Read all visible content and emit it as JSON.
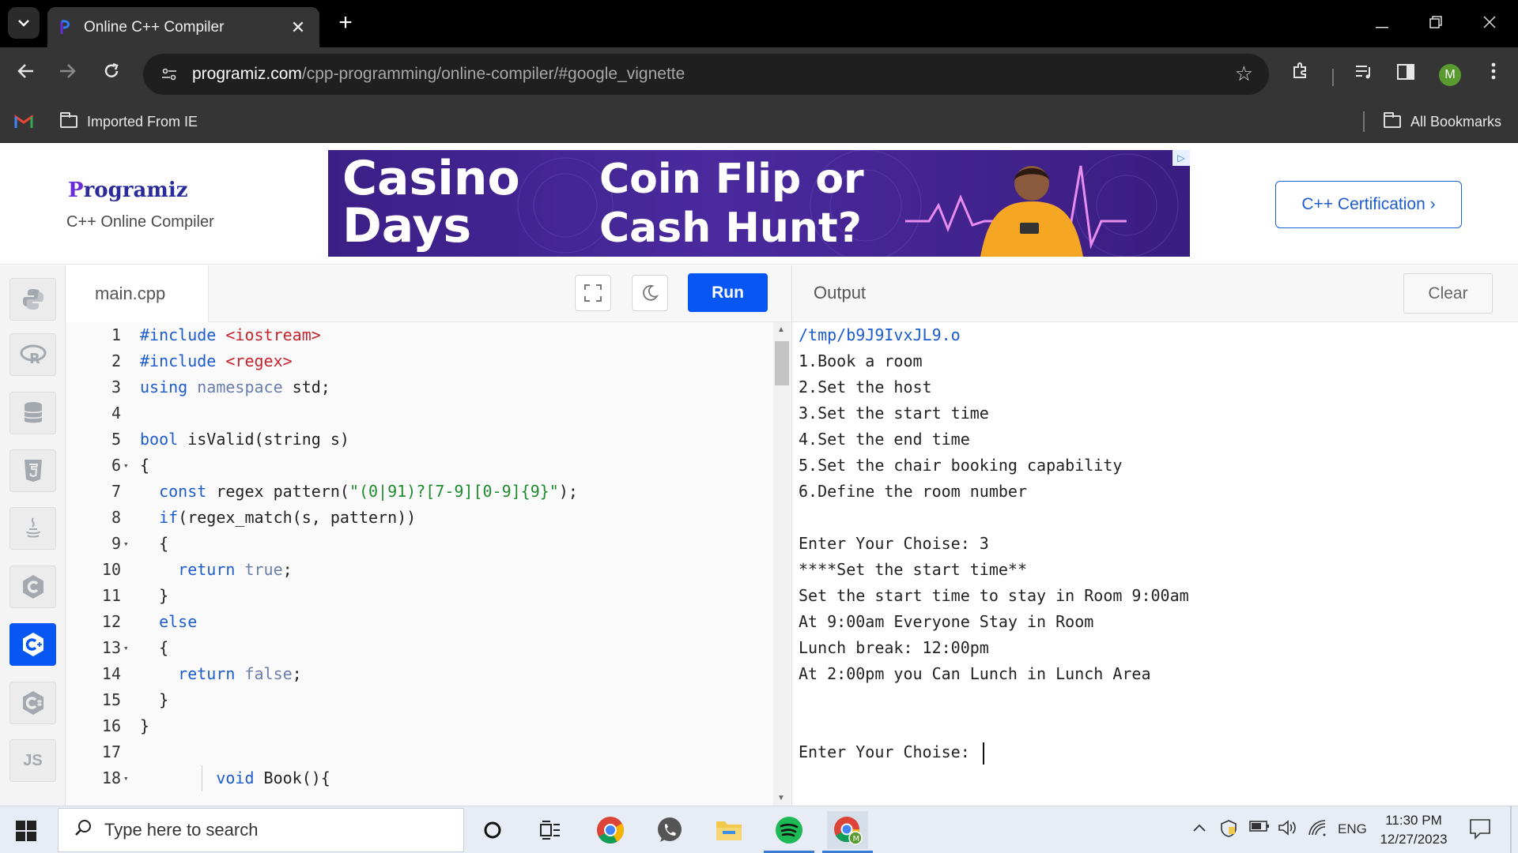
{
  "browser": {
    "tab_title": "Online C++ Compiler",
    "tab_close": "✕",
    "new_tab": "+",
    "url_host": "programiz.com",
    "url_path": "/cpp-programming/online-compiler/#google_vignette",
    "avatar_letter": "M",
    "bookmarks": {
      "imported": "Imported From IE",
      "all": "All Bookmarks"
    }
  },
  "header": {
    "logo_first": "P",
    "logo_rest": "rogramiz",
    "subtitle": "C++ Online Compiler",
    "ad_left": "Casino\nDays",
    "ad_right": "Coin Flip or\nCash Hunt?",
    "cert_button": "C++ Certification ›"
  },
  "sidebar": {
    "items": [
      {
        "icon": "python-icon",
        "glyph": "🐍"
      },
      {
        "icon": "r-icon",
        "glyph": "R"
      },
      {
        "icon": "sql-icon",
        "glyph": "⛁"
      },
      {
        "icon": "html5-icon",
        "glyph": "5"
      },
      {
        "icon": "java-icon",
        "glyph": "☕"
      },
      {
        "icon": "c-icon",
        "glyph": "C"
      },
      {
        "icon": "cpp-icon",
        "glyph": "C+"
      },
      {
        "icon": "csharp-icon",
        "glyph": "C#"
      },
      {
        "icon": "javascript-icon",
        "glyph": "JS"
      }
    ]
  },
  "editor": {
    "file_name": "main.cpp",
    "run_label": "Run",
    "lines": [
      {
        "n": "1",
        "fold": ""
      },
      {
        "n": "2",
        "fold": ""
      },
      {
        "n": "3",
        "fold": ""
      },
      {
        "n": "4",
        "fold": ""
      },
      {
        "n": "5",
        "fold": ""
      },
      {
        "n": "6",
        "fold": "▾"
      },
      {
        "n": "7",
        "fold": ""
      },
      {
        "n": "8",
        "fold": ""
      },
      {
        "n": "9",
        "fold": "▾"
      },
      {
        "n": "10",
        "fold": ""
      },
      {
        "n": "11",
        "fold": ""
      },
      {
        "n": "12",
        "fold": ""
      },
      {
        "n": "13",
        "fold": "▾"
      },
      {
        "n": "14",
        "fold": ""
      },
      {
        "n": "15",
        "fold": ""
      },
      {
        "n": "16",
        "fold": ""
      },
      {
        "n": "17",
        "fold": ""
      },
      {
        "n": "18",
        "fold": "▾"
      }
    ],
    "code": {
      "l1_kw": "#include",
      "l1_inc": " <iostream>",
      "l2_kw": "#include",
      "l2_inc": " <regex>",
      "l3_kw": "using",
      "l3_kw2": " namespace",
      "l3_rest": " std;",
      "l5_kw": "bool",
      "l5_rest": " isValid(string s)",
      "l6": "{",
      "l7_indent": "  ",
      "l7_kw": "const",
      "l7_mid": " regex pattern(",
      "l7_str": "\"(0|91)?[7-9][0-9]{9}\"",
      "l7_end": ");",
      "l8_indent": "  ",
      "l8_kw": "if",
      "l8_rest": "(regex_match(s, pattern))",
      "l9": "  {",
      "l10_indent": "    ",
      "l10_kw": "return",
      "l10_val": " true",
      "l10_end": ";",
      "l11": "  }",
      "l12_indent": "  ",
      "l12_kw": "else",
      "l13": "  {",
      "l14_indent": "    ",
      "l14_kw": "return",
      "l14_val": " false",
      "l14_end": ";",
      "l15": "  }",
      "l16": "}",
      "l18_indent": "        ",
      "l18_kw": "void",
      "l18_rest": " Book(){"
    }
  },
  "output": {
    "label": "Output",
    "clear_label": "Clear",
    "lines": [
      "/tmp/b9J9IvxJL9.o",
      "1.Book a room",
      "2.Set the host",
      "3.Set the start time",
      "4.Set the end time",
      "5.Set the chair booking capability",
      "6.Define the room number",
      "",
      "Enter Your Choise: 3",
      "****Set the start time**",
      "Set the start time to stay in Room 9:00am",
      "At 9:00am Everyone Stay in Room",
      "Lunch break: 12:00pm",
      "At 2:00pm you Can Lunch in Lunch Area",
      "",
      "",
      "Enter Your Choise: "
    ]
  },
  "taskbar": {
    "search_placeholder": "Type here to search",
    "lang": "ENG",
    "time": "11:30 PM",
    "date": "12/27/2023"
  }
}
